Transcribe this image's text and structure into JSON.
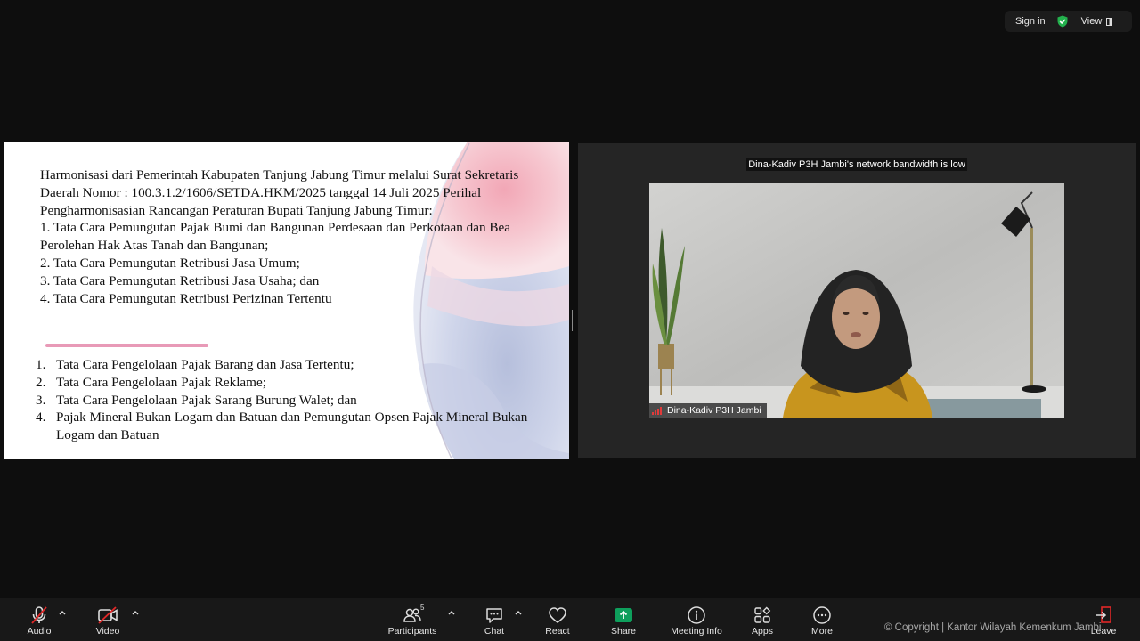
{
  "topbar": {
    "signin": "Sign in",
    "view": "View"
  },
  "slide": {
    "paragraph": [
      "Harmonisasi dari Pemerintah Kabupaten Tanjung Jabung Timur melalui Surat Sekretaris Daerah Nomor : 100.3.1.2/1606/SETDA.HKM/2025 tanggal 14 Juli 2025 Perihal Pengharmonisasian Rancangan Peraturan Bupati Tanjung Jabung Timur:",
      "1. Tata Cara Pemungutan Pajak Bumi dan Bangunan Perdesaan dan Perkotaan dan Bea Perolehan Hak Atas Tanah dan Bangunan;",
      "2. Tata Cara Pemungutan Retribusi Jasa Umum;",
      "3. Tata Cara Pemungutan Retribusi Jasa Usaha; dan",
      "4. Tata Cara Pemungutan Retribusi Perizinan Tertentu"
    ],
    "list": [
      {
        "num": "1.",
        "text": "Tata Cara Pengelolaan Pajak Barang dan Jasa Tertentu;"
      },
      {
        "num": "2.",
        "text": "Tata Cara Pengelolaan Pajak Reklame;"
      },
      {
        "num": "3.",
        "text": "Tata Cara Pengelolaan Pajak Sarang Burung Walet; dan"
      },
      {
        "num": "4.",
        "text": "Pajak Mineral Bukan Logam dan Batuan dan Pemungutan Opsen Pajak Mineral Bukan Logam dan Batuan"
      }
    ]
  },
  "video": {
    "bandwidth_notice": "Dina-Kadiv P3H Jambi's network bandwidth is low",
    "participant_name": "Dina-Kadiv P3H Jambi"
  },
  "toolbar": {
    "audio": "Audio",
    "video": "Video",
    "participants": "Participants",
    "participants_count": "5",
    "chat": "Chat",
    "react": "React",
    "share": "Share",
    "meeting_info": "Meeting Info",
    "apps": "Apps",
    "more": "More",
    "leave": "Leave"
  },
  "copyright": "© Copyright | Kantor Wilayah Kemenkum Jambi",
  "colors": {
    "share_green": "#0e9f5c",
    "muted_red": "#e02828",
    "shield_green": "#23b14d"
  }
}
